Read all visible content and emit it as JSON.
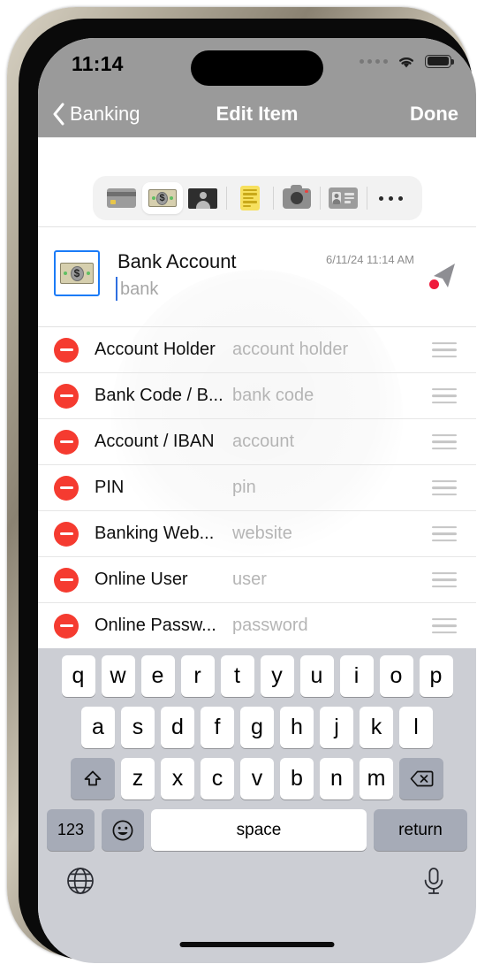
{
  "status_bar": {
    "time": "11:14",
    "signal_icon": "signal-dots-icon",
    "wifi_icon": "wifi-icon",
    "battery_icon": "battery-icon"
  },
  "nav_bar": {
    "back_icon": "chevron-left-icon",
    "back_label": "Banking",
    "title": "Edit Item",
    "done_label": "Done"
  },
  "toolbar": {
    "items": [
      {
        "icon": "credit-card-icon",
        "selected": false
      },
      {
        "icon": "banknote-icon",
        "selected": true
      },
      {
        "icon": "person-photo-icon",
        "selected": false
      },
      {
        "icon": "yellow-note-icon",
        "selected": false
      },
      {
        "icon": "camera-icon",
        "selected": false
      },
      {
        "icon": "id-card-icon",
        "selected": false
      }
    ],
    "more_icon": "ellipsis-icon"
  },
  "item": {
    "thumbnail_icon": "banknote-icon",
    "title": "Bank Account",
    "subtitle_placeholder": "bank",
    "date": "6/11/24 11:14 AM",
    "send_icon": "send-arrow-icon",
    "badge_icon": "red-dot-badge"
  },
  "fields": [
    {
      "delete_icon": "minus-circle-icon",
      "label": "Account Holder",
      "placeholder": "account holder",
      "grip_icon": "reorder-grip-icon"
    },
    {
      "delete_icon": "minus-circle-icon",
      "label": "Bank Code / B...",
      "placeholder": "bank code",
      "grip_icon": "reorder-grip-icon"
    },
    {
      "delete_icon": "minus-circle-icon",
      "label": "Account / IBAN",
      "placeholder": "account",
      "grip_icon": "reorder-grip-icon"
    },
    {
      "delete_icon": "minus-circle-icon",
      "label": "PIN",
      "placeholder": "pin",
      "grip_icon": "reorder-grip-icon"
    },
    {
      "delete_icon": "minus-circle-icon",
      "label": "Banking Web...",
      "placeholder": "website",
      "grip_icon": "reorder-grip-icon"
    },
    {
      "delete_icon": "minus-circle-icon",
      "label": "Online User",
      "placeholder": "user",
      "grip_icon": "reorder-grip-icon"
    },
    {
      "delete_icon": "minus-circle-icon",
      "label": "Online Passw...",
      "placeholder": "password",
      "grip_icon": "reorder-grip-icon"
    }
  ],
  "keyboard": {
    "row1": [
      "q",
      "w",
      "e",
      "r",
      "t",
      "y",
      "u",
      "i",
      "o",
      "p"
    ],
    "row2": [
      "a",
      "s",
      "d",
      "f",
      "g",
      "h",
      "j",
      "k",
      "l"
    ],
    "row3": [
      "z",
      "x",
      "c",
      "v",
      "b",
      "n",
      "m"
    ],
    "shift_icon": "shift-arrow-icon",
    "backspace_icon": "backspace-icon",
    "numbers_label": "123",
    "emoji_icon": "emoji-smiley-icon",
    "space_label": "space",
    "return_label": "return",
    "globe_icon": "globe-icon",
    "mic_icon": "microphone-icon"
  },
  "colors": {
    "nav_bar": "#9a9a9a",
    "delete_red": "#f53b30",
    "selection_blue": "#1b7bf7",
    "note_yellow": "#f7e05e",
    "keyboard_bg": "#ccced4"
  }
}
